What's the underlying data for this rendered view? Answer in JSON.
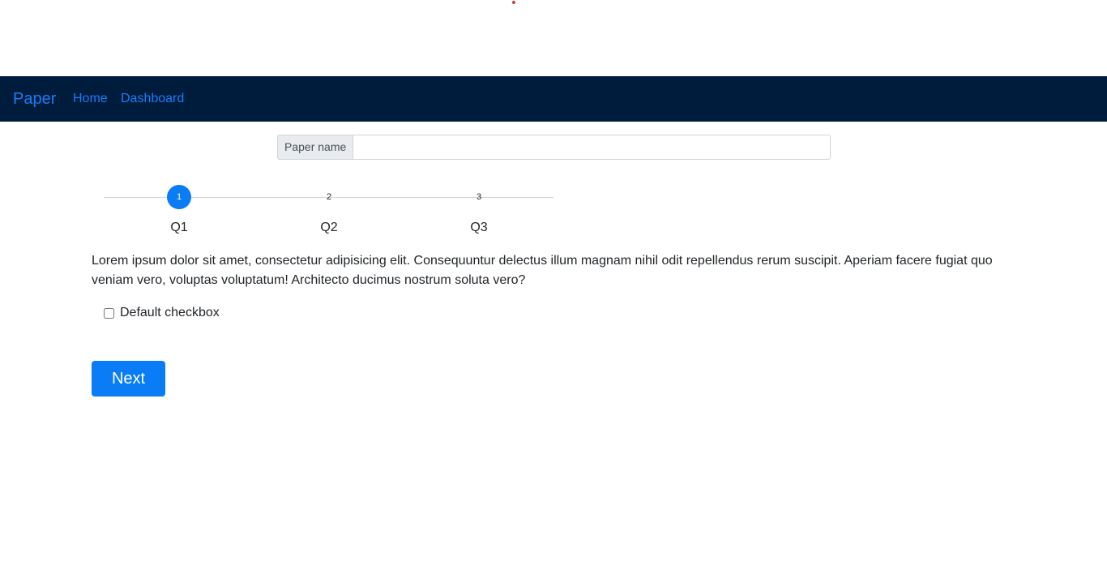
{
  "navbar": {
    "brand": "Paper",
    "links": [
      {
        "label": "Home"
      },
      {
        "label": "Dashboard"
      }
    ]
  },
  "paper_form": {
    "prepend_label": "Paper name",
    "input_value": "",
    "input_placeholder": ""
  },
  "stepper": {
    "active_step": 1,
    "steps": [
      {
        "number": "1",
        "label": "Q1"
      },
      {
        "number": "2",
        "label": "Q2"
      },
      {
        "number": "3",
        "label": "Q3"
      }
    ]
  },
  "question": {
    "text": "Lorem ipsum dolor sit amet, consectetur adipisicing elit. Consequuntur delectus illum magnam nihil odit repellendus rerum suscipit. Aperiam facere fugiat quo veniam vero, voluptas voluptatum! Architecto ducimus nostrum soluta vero?",
    "checkbox_label": "Default checkbox",
    "checkbox_checked": false
  },
  "actions": {
    "next_label": "Next"
  },
  "colors": {
    "navbar_bg": "#001c3d",
    "accent": "#0a7cf5",
    "link": "#1a7cf5"
  }
}
